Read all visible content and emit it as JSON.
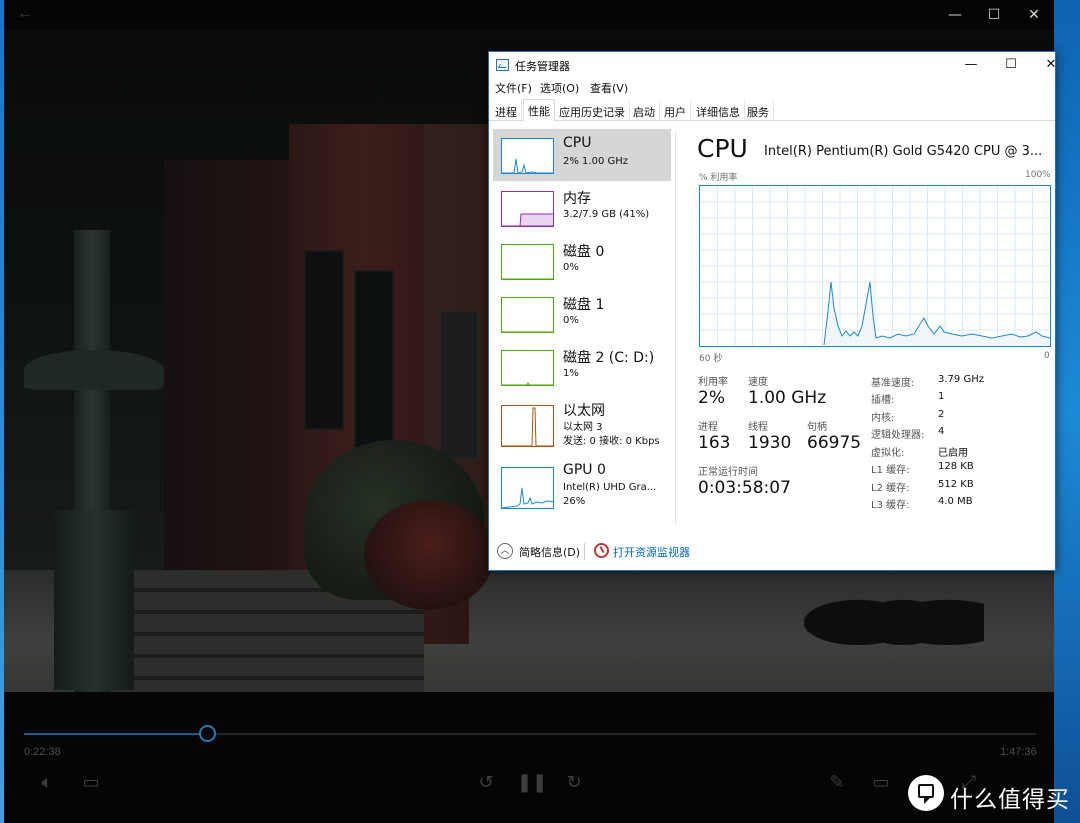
{
  "player": {
    "back_icon": "←",
    "time_current": "0:22:38",
    "time_total": "1:47:36",
    "progress_fraction": 0.181
  },
  "taskmgr": {
    "title": "任务管理器",
    "menu": [
      "文件(F)",
      "选项(O)",
      "查看(V)"
    ],
    "tabs": [
      "进程",
      "性能",
      "应用历史记录",
      "启动",
      "用户",
      "详细信息",
      "服务"
    ],
    "active_tab": "性能",
    "sidebar": [
      {
        "name": "CPU",
        "sub": [
          "2% 1.00 GHz"
        ],
        "color": "#1d87d0"
      },
      {
        "name": "内存",
        "sub": [
          "3.2/7.9 GB (41%)"
        ],
        "color": "#8e2fb0"
      },
      {
        "name": "磁盘 0",
        "sub": [
          "0%"
        ],
        "color": "#4da60f"
      },
      {
        "name": "磁盘 1",
        "sub": [
          "0%"
        ],
        "color": "#4da60f"
      },
      {
        "name": "磁盘 2 (C: D:)",
        "sub": [
          "1%"
        ],
        "color": "#4da60f"
      },
      {
        "name": "以太网",
        "sub": [
          "以太网 3",
          "发送: 0 接收: 0 Kbps"
        ],
        "color": "#a7531d"
      },
      {
        "name": "GPU 0",
        "sub": [
          "Intel(R) UHD Gra...",
          "26%"
        ],
        "color": "#1d87d0"
      }
    ],
    "main": {
      "heading": "CPU",
      "model": "Intel(R) Pentium(R) Gold G5420 CPU @ 3...",
      "graph_label": "% 利用率",
      "graph_max": "100%",
      "graph_time": "60 秒",
      "graph_min": "0",
      "stats": {
        "util_label": "利用率",
        "util_value": "2%",
        "speed_label": "速度",
        "speed_value": "1.00 GHz",
        "proc_label": "进程",
        "proc_value": "163",
        "thread_label": "线程",
        "thread_value": "1930",
        "handle_label": "句柄",
        "handle_value": "66975",
        "uptime_label": "正常运行时间",
        "uptime_value": "0:03:58:07"
      },
      "details": [
        {
          "k": "基准速度:",
          "v": "3.79 GHz"
        },
        {
          "k": "插槽:",
          "v": "1"
        },
        {
          "k": "内核:",
          "v": "2"
        },
        {
          "k": "逻辑处理器:",
          "v": "4"
        },
        {
          "k": "虚拟化:",
          "v": "已启用"
        },
        {
          "k": "L1 缓存:",
          "v": "128 KB"
        },
        {
          "k": "L2 缓存:",
          "v": "512 KB"
        },
        {
          "k": "L3 缓存:",
          "v": "4.0 MB"
        }
      ]
    },
    "footer": {
      "brief": "简略信息(D)",
      "resmon": "打开资源监视器"
    }
  },
  "watermark": {
    "text": "什么值得买"
  }
}
